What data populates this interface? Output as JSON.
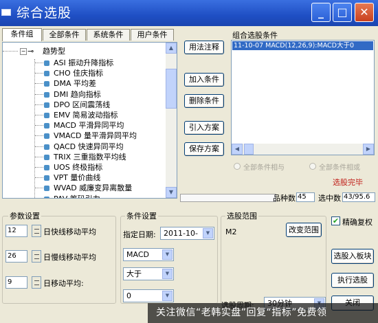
{
  "window": {
    "title": "综合选股"
  },
  "tabs": [
    {
      "label": "条件组",
      "active": true
    },
    {
      "label": "全部条件",
      "active": false
    },
    {
      "label": "系统条件",
      "active": false
    },
    {
      "label": "用户条件",
      "active": false
    }
  ],
  "tree": {
    "root": "趋势型",
    "items": [
      "ASI 振动升降指标",
      "CHO 佳庆指标",
      "DMA 平均差",
      "DMI 趋向指标",
      "DPO 区间震荡线",
      "EMV 简易波动指标",
      "MACD 平滑异同平均",
      "VMACD 量平滑异同平均",
      "QACD 快速异同平均",
      "TRIX 三重指数平均线",
      "UOS 终极指标",
      "VPT 量价曲线",
      "WVAD 威廉变异离散量",
      "PAV 筹码引力"
    ]
  },
  "mid_buttons": {
    "usage": "用法注释",
    "add": "加入条件",
    "delete": "删除条件",
    "import": "引入方案",
    "save": "保存方案"
  },
  "combo": {
    "label": "组合选股条件",
    "items": [
      "11-10-07 MACD(12,26,9):MACD大于0"
    ],
    "radio_all_and": "全部条件相与",
    "radio_all_or": "全部条件相或",
    "status": "选股完毕"
  },
  "stats": {
    "count_label": "品种数",
    "count_value": "45",
    "hit_label": "选中数",
    "hit_value": "43/95.6"
  },
  "params": {
    "title": "参数设置",
    "rows": [
      {
        "value": "12",
        "label": "日快线移动平均"
      },
      {
        "value": "26",
        "label": "日慢线移动平均"
      },
      {
        "value": "9",
        "label": "日移动平均:"
      }
    ]
  },
  "conditions": {
    "title": "条件设置",
    "date_label": "指定日期:",
    "date_value": "2011-10-",
    "indicator": "MACD",
    "operator": "大于",
    "threshold": "0"
  },
  "scope": {
    "title": "选股范围",
    "value": "M2",
    "change_button": "改变范围",
    "period_label": "选股周期:",
    "period_value": "30分钟"
  },
  "right_panel": {
    "exact_label": "精确复权",
    "exact_checked": true,
    "to_board_button": "选股入板块",
    "run_button": "执行选股",
    "close_button": "关闭"
  },
  "watermark": "关注微信“老韩实盘”回复“指标”免费领"
}
